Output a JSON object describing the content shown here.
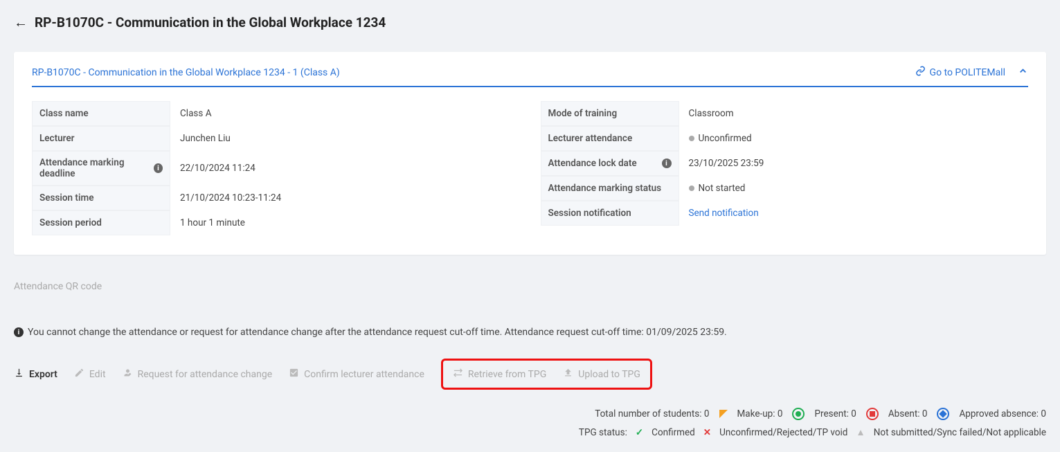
{
  "header": {
    "title": "RP-B1070C - Communication in the Global Workplace 1234"
  },
  "card": {
    "breadcrumb": "RP-B1070C - Communication in the Global Workplace 1234 - 1 (Class A)",
    "politemall_label": "Go to POLITEMall"
  },
  "details_left": {
    "class_name_label": "Class name",
    "class_name_value": "Class A",
    "lecturer_label": "Lecturer",
    "lecturer_value": "Junchen Liu",
    "deadline_label": "Attendance marking deadline",
    "deadline_value": "22/10/2024 11:24",
    "session_time_label": "Session time",
    "session_time_value": "21/10/2024 10:23-11:24",
    "session_period_label": "Session period",
    "session_period_value": "1 hour 1 minute"
  },
  "details_right": {
    "mode_label": "Mode of training",
    "mode_value": "Classroom",
    "lect_att_label": "Lecturer attendance",
    "lect_att_value": "Unconfirmed",
    "lock_label": "Attendance lock date",
    "lock_value": "23/10/2025 23:59",
    "mark_status_label": "Attendance marking status",
    "mark_status_value": "Not started",
    "notif_label": "Session notification",
    "notif_link": "Send notification"
  },
  "qr_label": "Attendance QR code",
  "notice_text": "You cannot change the attendance or request for attendance change after the attendance request cut-off time. Attendance request cut-off time: 01/09/2025 23:59.",
  "actions": {
    "export": "Export",
    "edit": "Edit",
    "request": "Request for attendance change",
    "confirm": "Confirm lecturer attendance",
    "retrieve": "Retrieve from TPG",
    "upload": "Upload to TPG"
  },
  "summary": {
    "total_label": "Total number of students:",
    "total_value": "0",
    "makeup_label": "Make-up:",
    "makeup_value": "0",
    "present_label": "Present:",
    "present_value": "0",
    "absent_label": "Absent:",
    "absent_value": "0",
    "approved_label": "Approved absence:",
    "approved_value": "0"
  },
  "tpg": {
    "status_label": "TPG status:",
    "confirmed": "Confirmed",
    "unconfirmed": "Unconfirmed/Rejected/TP void",
    "notsubmitted": "Not submitted/Sync failed/Not applicable"
  }
}
